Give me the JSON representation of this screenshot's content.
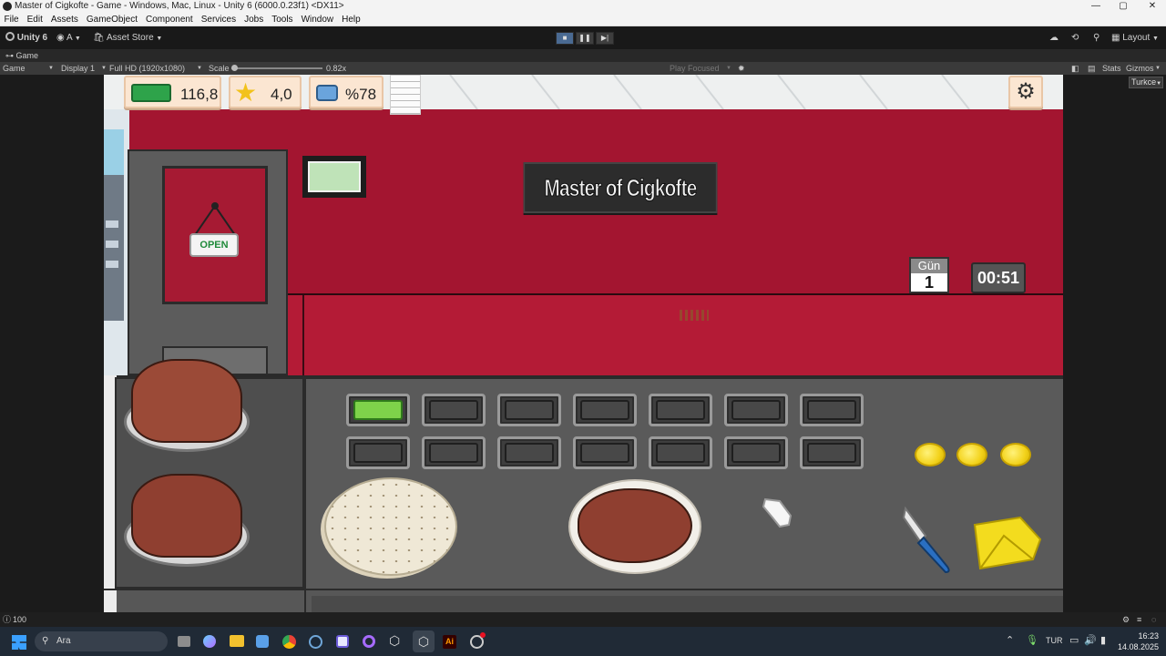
{
  "window": {
    "title": "Master of Cigkofte - Game - Windows, Mac, Linux - Unity 6 (6000.0.23f1) <DX11>",
    "controls": [
      "—",
      "▢",
      "✕"
    ]
  },
  "menu": [
    "File",
    "Edit",
    "Assets",
    "GameObject",
    "Component",
    "Services",
    "Jobs",
    "Tools",
    "Window",
    "Help"
  ],
  "toolbar": {
    "unity_label": "Unity 6",
    "account": "A",
    "asset_store": "Asset Store",
    "layout": "Layout"
  },
  "game_tab": {
    "tab_label": "Game",
    "view_mode": "Game",
    "display": "Display 1",
    "resolution": "Full HD (1920x1080)",
    "scale_label": "Scale",
    "scale_value": "0.82x",
    "play_focused": "Play Focused",
    "stats": "Stats",
    "gizmos": "Gizmos",
    "language": "Turkce"
  },
  "game": {
    "money": "116,8",
    "rating": "4,0",
    "satisfaction": "%78",
    "shop_sign": "Master of Cigkofte",
    "door_sign": "OPEN",
    "day_label": "Gün",
    "day_number": "1",
    "timer": "00:51"
  },
  "status": {
    "count": "100"
  },
  "taskbar": {
    "search_placeholder": "Ara",
    "language": "TUR",
    "time": "16:23",
    "date": "14.08.2025"
  },
  "colors": {
    "wall": "#a31530",
    "counter": "#575757",
    "hud": "#fbe6d2",
    "unity_bg": "#191919"
  }
}
